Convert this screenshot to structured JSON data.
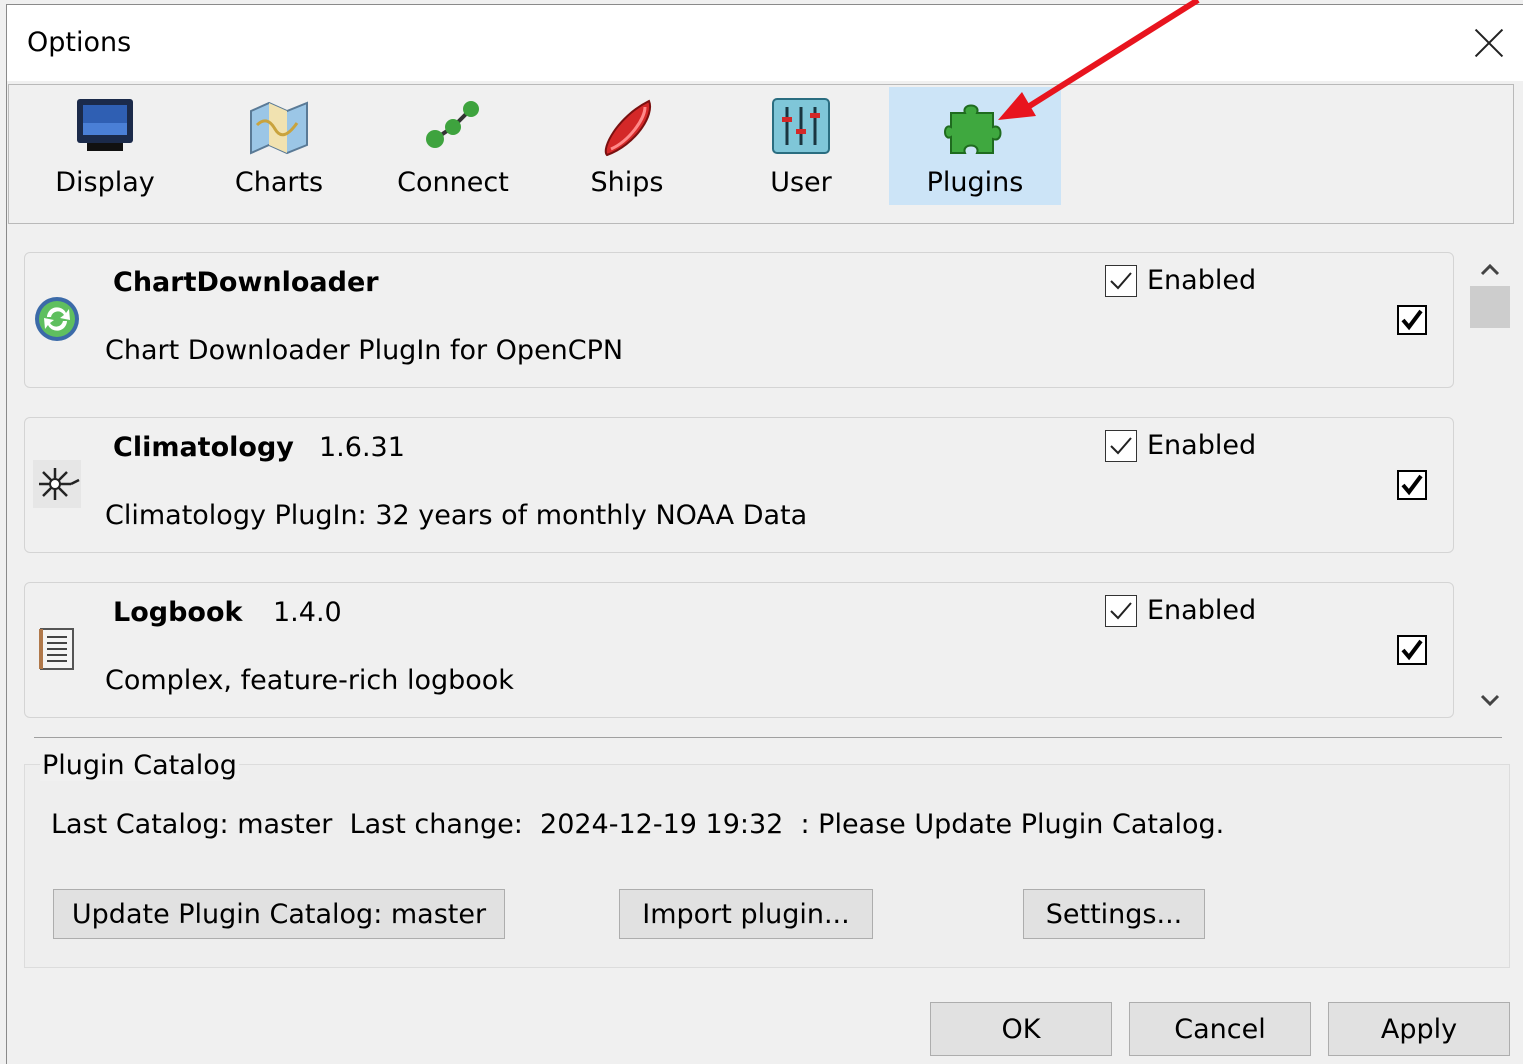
{
  "window": {
    "title": "Options"
  },
  "tabs": [
    {
      "label": "Display",
      "icon": "monitor-icon"
    },
    {
      "label": "Charts",
      "icon": "chart-map-icon"
    },
    {
      "label": "Connect",
      "icon": "connect-icon"
    },
    {
      "label": "Ships",
      "icon": "ship-icon"
    },
    {
      "label": "User",
      "icon": "sliders-icon"
    },
    {
      "label": "Plugins",
      "icon": "puzzle-icon",
      "active": true
    }
  ],
  "plugins": [
    {
      "name": "ChartDownloader",
      "version": "",
      "description": "Chart Downloader PlugIn for OpenCPN",
      "enabled_label": "Enabled",
      "enabled": true,
      "icon": "refresh-icon"
    },
    {
      "name": "Climatology",
      "version": "1.6.31",
      "description": "Climatology PlugIn: 32 years of monthly NOAA Data",
      "enabled_label": "Enabled",
      "enabled": true,
      "icon": "climatology-icon"
    },
    {
      "name": "Logbook",
      "version": "1.4.0",
      "description": "Complex, feature-rich logbook",
      "enabled_label": "Enabled",
      "enabled": true,
      "icon": "logbook-icon"
    }
  ],
  "catalog": {
    "title": "Plugin Catalog",
    "info": "Last Catalog: master  Last change:  2024-12-19 19:32  : Please Update Plugin Catalog.",
    "update_button": "Update Plugin Catalog: master",
    "import_button": "Import plugin...",
    "settings_button": "Settings..."
  },
  "footer": {
    "ok": "OK",
    "cancel": "Cancel",
    "apply": "Apply"
  },
  "colors": {
    "active_tab": "#cce4f7",
    "annotation_arrow": "#e8141e"
  }
}
